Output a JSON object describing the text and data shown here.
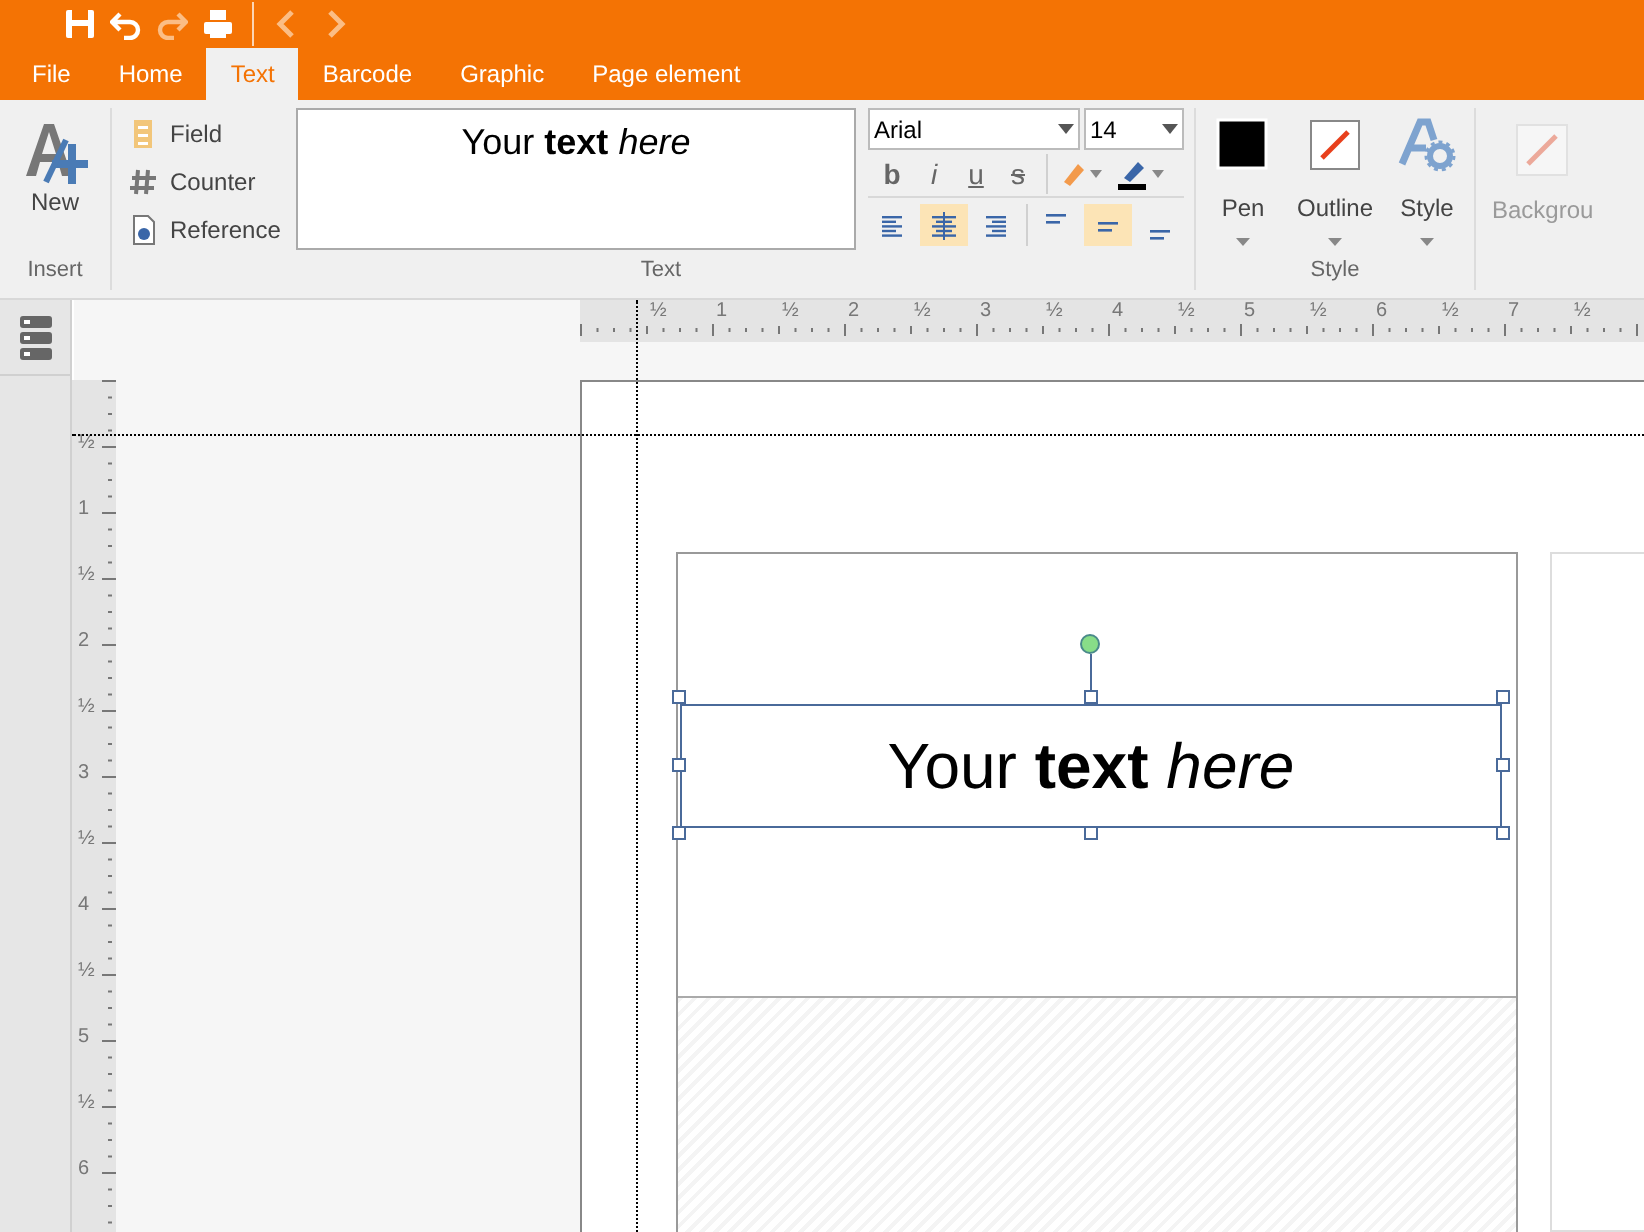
{
  "quick_access": [
    {
      "kind": "save",
      "disabled": false
    },
    {
      "kind": "undo",
      "disabled": false
    },
    {
      "kind": "redo",
      "disabled": true
    },
    {
      "kind": "print",
      "disabled": false
    },
    {
      "kind": "back",
      "disabled": true
    },
    {
      "kind": "forward",
      "disabled": true
    }
  ],
  "tabs": [
    {
      "label": "File",
      "selected": false
    },
    {
      "label": "Home",
      "selected": false
    },
    {
      "label": "Text",
      "selected": true
    },
    {
      "label": "Barcode",
      "selected": false
    },
    {
      "label": "Graphic",
      "selected": false
    },
    {
      "label": "Page element",
      "selected": false
    }
  ],
  "ribbon": {
    "insert": {
      "label": "Insert",
      "new_button": "New"
    },
    "text": {
      "label": "Text",
      "items": [
        {
          "kind": "field",
          "label": "Field"
        },
        {
          "kind": "counter",
          "label": "Counter"
        },
        {
          "kind": "reference",
          "label": "Reference"
        }
      ],
      "preview": "Your **text** *here*",
      "font": "Arial",
      "size": "14",
      "format_buttons": [
        {
          "kind": "bold",
          "label": "b"
        },
        {
          "kind": "italic",
          "label": "i"
        },
        {
          "kind": "underline",
          "label": "u"
        },
        {
          "kind": "strike",
          "label": "s"
        }
      ],
      "horizontal_align": [
        {
          "kind": "left",
          "selected": false
        },
        {
          "kind": "center",
          "selected": true
        },
        {
          "kind": "right",
          "selected": false
        }
      ],
      "vertical_align": [
        {
          "kind": "top",
          "selected": false
        },
        {
          "kind": "middle",
          "selected": true
        },
        {
          "kind": "bottom",
          "selected": false
        }
      ]
    },
    "style": {
      "label": "Style",
      "buttons": [
        {
          "kind": "pen",
          "label": "Pen"
        },
        {
          "kind": "outline",
          "label": "Outline"
        },
        {
          "kind": "style",
          "label": "Style"
        }
      ]
    },
    "background": {
      "label": "Backgrou",
      "disabled": true
    }
  },
  "canvas": {
    "horizontal_ruler": [
      "½",
      "1",
      "½",
      "2",
      "½",
      "3",
      "½",
      "4",
      "½",
      "5",
      "½",
      "6",
      "½",
      "7",
      "½"
    ],
    "vertical_ruler": [
      "½",
      "1",
      "½",
      "2",
      "½",
      "3",
      "½",
      "4",
      "½",
      "5",
      "½",
      "6"
    ],
    "text_object": "Your **text** *here*"
  }
}
